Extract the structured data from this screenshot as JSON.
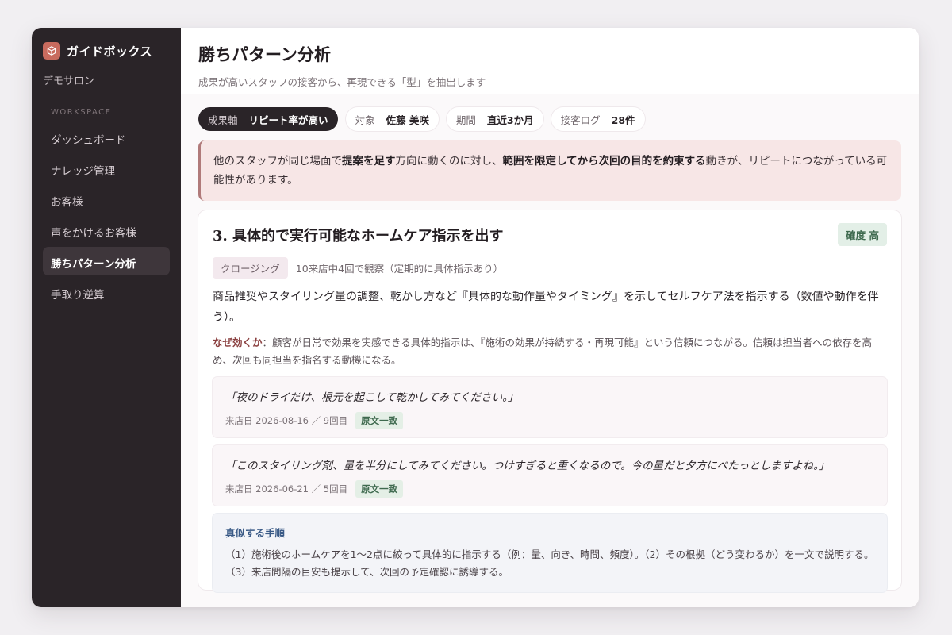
{
  "brand": {
    "name": "ガイドボックス",
    "icon": "box-icon",
    "accent": "#c86b5e"
  },
  "salon": "デモサロン",
  "sidebar": {
    "section_label": "WORKSPACE",
    "items": [
      {
        "label": "ダッシュボード",
        "active": false
      },
      {
        "label": "ナレッジ管理",
        "active": false
      },
      {
        "label": "お客様",
        "active": false
      },
      {
        "label": "声をかけるお客様",
        "active": false
      },
      {
        "label": "勝ちパターン分析",
        "active": true
      },
      {
        "label": "手取り逆算",
        "active": false
      }
    ]
  },
  "header": {
    "title": "勝ちパターン分析",
    "subtitle": "成果が高いスタッフの接客から、再現できる「型」を抽出します"
  },
  "filters": [
    {
      "key": "成果軸",
      "value": "リピート率が高い"
    },
    {
      "key": "対象",
      "value": "佐藤 美咲"
    },
    {
      "key": "期間",
      "value": "直近3か月"
    },
    {
      "key": "接客ログ",
      "value": "28件"
    }
  ],
  "insight": {
    "t1": "他のスタッフが同じ場面で",
    "b1": "提案を足す",
    "t2": "方向に動くのに対し、",
    "b2": "範囲を限定してから次回の目的を約束する",
    "t3": "動きが、リピートにつながっている可能性があります。"
  },
  "pattern": {
    "title": "3. 具体的で実行可能なホームケア指示を出す",
    "confidence": "確度 高",
    "tag": "クロージング",
    "observed": "10来店中4回で観察（定期的に具体指示あり）",
    "description": "商品推奨やスタイリング量の調整、乾かし方など『具体的な動作量やタイミング』を示してセルフケア法を指示する（数値や動作を伴う）。",
    "why_label": "なぜ効くか",
    "why_text": "：顧客が日常で効果を実感できる具体的指示は、『施術の効果が持続する・再現可能』という信頼につながる。信頼は担当者への依存を高め、次回も同担当を指名する動機になる。",
    "quotes": [
      {
        "text": "「夜のドライだけ、根元を起こして乾かしてみてください。」",
        "date": "来店日 2026-08-16 ／ 9回目",
        "badge": "原文一致"
      },
      {
        "text": "「このスタイリング剤、量を半分にしてみてください。つけすぎると重くなるので。今の量だと夕方にぺたっとしますよね。」",
        "date": "来店日 2026-06-21 ／ 5回目",
        "badge": "原文一致"
      }
    ],
    "steps_title": "真似する手順",
    "steps_body": "（1）施術後のホームケアを1〜2点に絞って具体的に指示する（例：量、向き、時間、頻度）。（2）その根拠（どう変わるか）を一文で説明する。（3）来店間隔の目安も提示して、次回の予定確認に誘導する。"
  }
}
